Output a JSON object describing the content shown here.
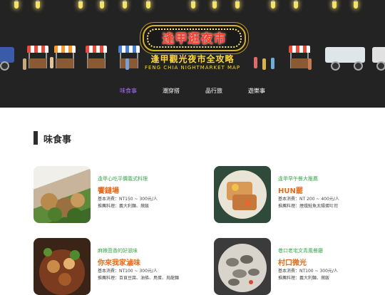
{
  "hero": {
    "sign_text": "逢甲逛夜市",
    "subtitle": "逢甲觀光夜市全攻略",
    "subtitle_en": "FENG CHIA NIGHTMARKET MAP"
  },
  "nav": {
    "items": [
      {
        "label": "味食事",
        "active": true
      },
      {
        "label": "潮穿搭",
        "active": false
      },
      {
        "label": "品行旅",
        "active": false
      },
      {
        "label": "遊樂事",
        "active": false
      }
    ]
  },
  "section": {
    "title": "味食事"
  },
  "cards": [
    {
      "tag": "逢甲心吃平價義式料理",
      "name": "饗鏈場",
      "price": "基本消費：NT150 ~ 300元/人",
      "dishes": "推薦料理：義大利麵、燉飯"
    },
    {
      "tag": "逢甲早午餐大推薦",
      "name": "HUN罷",
      "price": "基本消費：NT 200 ~ 400元/人",
      "dishes": "推薦料理：煙燻鮭魚太陽蛋吐司"
    },
    {
      "tag": "麻辣茴香的好滋味",
      "name": "你來我家滷味",
      "price": "基本消費：NT100 ~ 300元/人",
      "dishes": "推薦料理：百頁豆腐、油條、鳥蛋、烏龍麵"
    },
    {
      "tag": "巷口老宅文青風餐廳",
      "name": "村口微光",
      "price": "基本消費：NT100 ~ 300元/人",
      "dishes": "推薦料理：義大利麵、燉飯"
    }
  ],
  "colors": {
    "hero_bg": "#232323",
    "sign_red": "#ff3a2a",
    "gold": "#ffd93a",
    "nav_active": "#a06cf0",
    "tag_green": "#3aa64a",
    "name_orange": "#e46b1c"
  }
}
